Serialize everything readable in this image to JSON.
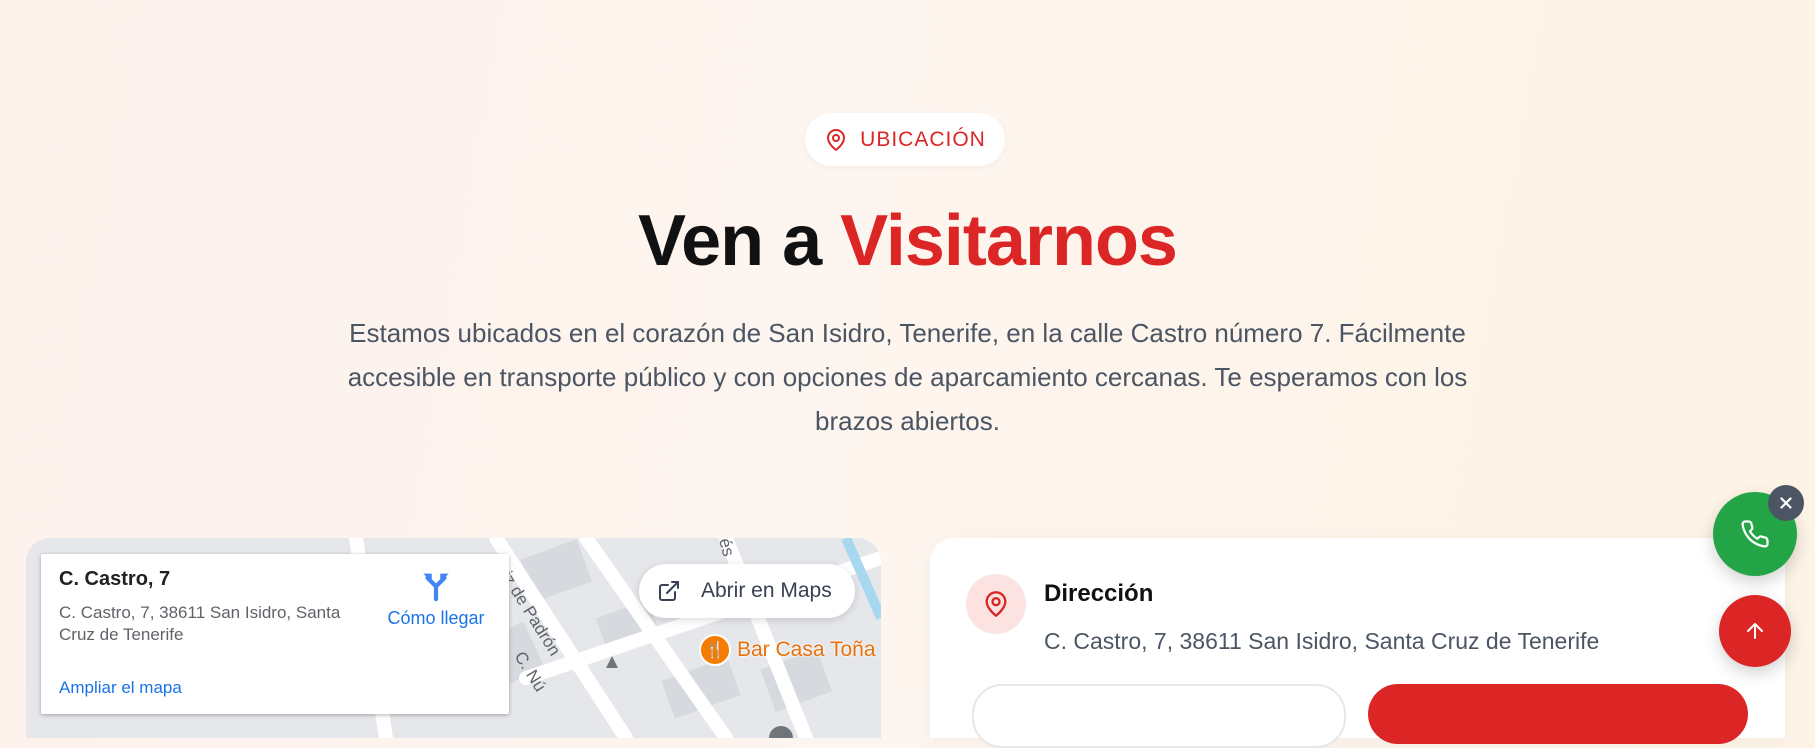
{
  "badge": {
    "label": "UBICACIÓN",
    "icon": "map-pin-icon"
  },
  "heading": {
    "prefix": "Ven a",
    "accent": "Visitarnos"
  },
  "description": "Estamos ubicados en el corazón de San Isidro, Tenerife, en la calle Castro número 7. Fácilmente accesible en transporte público y con opciones de aparcamiento cercanas. Te esperamos con los brazos abiertos.",
  "map": {
    "place_name": "C. Castro, 7",
    "place_address": "C. Castro, 7, 38611 San Isidro, Santa Cruz de Tenerife",
    "directions_label": "Cómo llegar",
    "enlarge_label": "Ampliar el mapa",
    "open_maps_label": "Abrir en Maps",
    "poi_label": "Bar Casa Toña",
    "street_labels": [
      "uiz de Padrón",
      "C. Nú",
      "és"
    ]
  },
  "info": {
    "address_title": "Dirección",
    "address_value": "C. Castro, 7, 38611 San Isidro, Santa Cruz de Tenerife"
  },
  "colors": {
    "accent": "#dc2626",
    "whatsapp_green": "#22a447",
    "close_gray": "#4b5563",
    "link_blue": "#1a73e8",
    "poi_orange": "#f57c00"
  }
}
